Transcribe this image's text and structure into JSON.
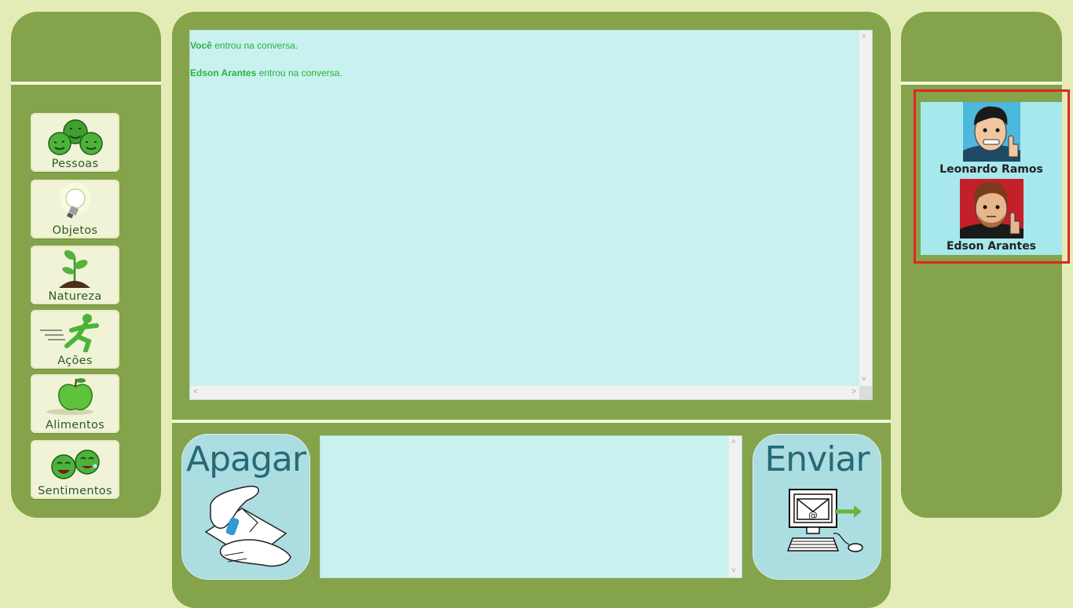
{
  "categories": [
    {
      "label": "Pessoas",
      "icon": "people-smileys-icon"
    },
    {
      "label": "Objetos",
      "icon": "lightbulb-icon"
    },
    {
      "label": "Natureza",
      "icon": "plant-sprout-icon"
    },
    {
      "label": "Ações",
      "icon": "running-person-icon"
    },
    {
      "label": "Alimentos",
      "icon": "apple-icon"
    },
    {
      "label": "Sentimentos",
      "icon": "laughing-faces-icon"
    }
  ],
  "chat": {
    "messages": [
      {
        "author": "Você",
        "text": " entrou na conversa."
      },
      {
        "author": "Edson Arantes",
        "text": " entrou na conversa."
      }
    ]
  },
  "compose": {
    "clear_label": "Apagar",
    "send_label": "Enviar",
    "message_value": ""
  },
  "users": [
    {
      "name": "Leonardo Ramos",
      "avatar": "avatar-blue-background"
    },
    {
      "name": "Edson Arantes",
      "avatar": "avatar-red-background"
    }
  ],
  "colors": {
    "background": "#e3ecb6",
    "panel": "#84a34b",
    "chat_bg": "#c9f1ef",
    "message_text": "#27b33a",
    "highlight": "#e42328"
  }
}
